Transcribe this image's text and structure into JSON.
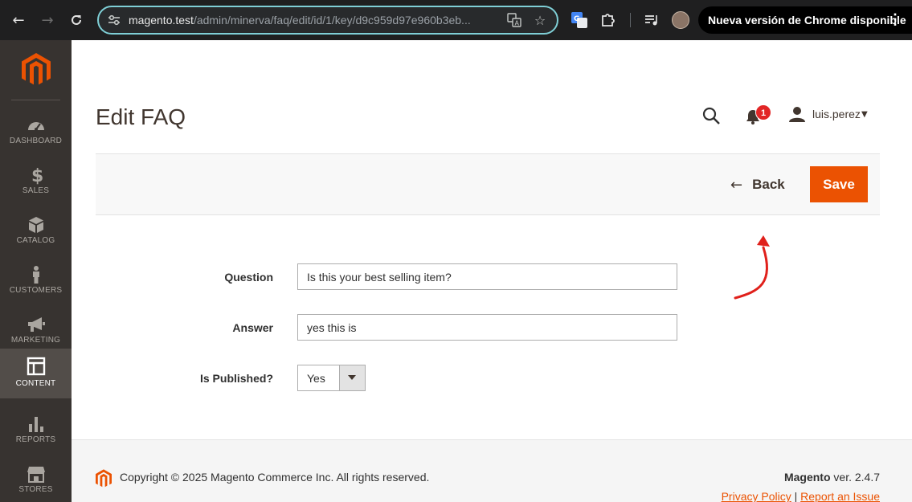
{
  "browser": {
    "url_host": "magento.test",
    "url_path": "/admin/minerva/faq/edit/id/1/key/d9c959d97e960b3eb...",
    "update_label": "Nueva versión de Chrome disponible"
  },
  "sidebar": {
    "items": [
      {
        "label": "Dashboard",
        "icon": "dashboard-icon"
      },
      {
        "label": "Sales",
        "icon": "dollar-icon"
      },
      {
        "label": "Catalog",
        "icon": "box-icon"
      },
      {
        "label": "Customers",
        "icon": "person-icon"
      },
      {
        "label": "Marketing",
        "icon": "megaphone-icon"
      },
      {
        "label": "Content",
        "icon": "layout-icon",
        "active": true
      },
      {
        "label": "Reports",
        "icon": "bar-chart-icon"
      },
      {
        "label": "Stores",
        "icon": "store-icon"
      }
    ]
  },
  "header": {
    "title": "Edit FAQ",
    "notification_count": "1",
    "user": "luis.perez"
  },
  "actions": {
    "back_label": "Back",
    "save_label": "Save"
  },
  "form": {
    "question_label": "Question",
    "question_value": "Is this your best selling item?",
    "answer_label": "Answer",
    "answer_value": "yes this is",
    "published_label": "Is Published?",
    "published_value": "Yes"
  },
  "footer": {
    "copyright": "Copyright © 2025 Magento Commerce Inc. All rights reserved.",
    "brand": "Magento",
    "version": "ver. 2.4.7",
    "privacy": "Privacy Policy",
    "separator": "|",
    "report": "Report an Issue"
  },
  "colors": {
    "accent": "#eb5202",
    "sidebar": "#373330",
    "badge": "#e22626"
  }
}
